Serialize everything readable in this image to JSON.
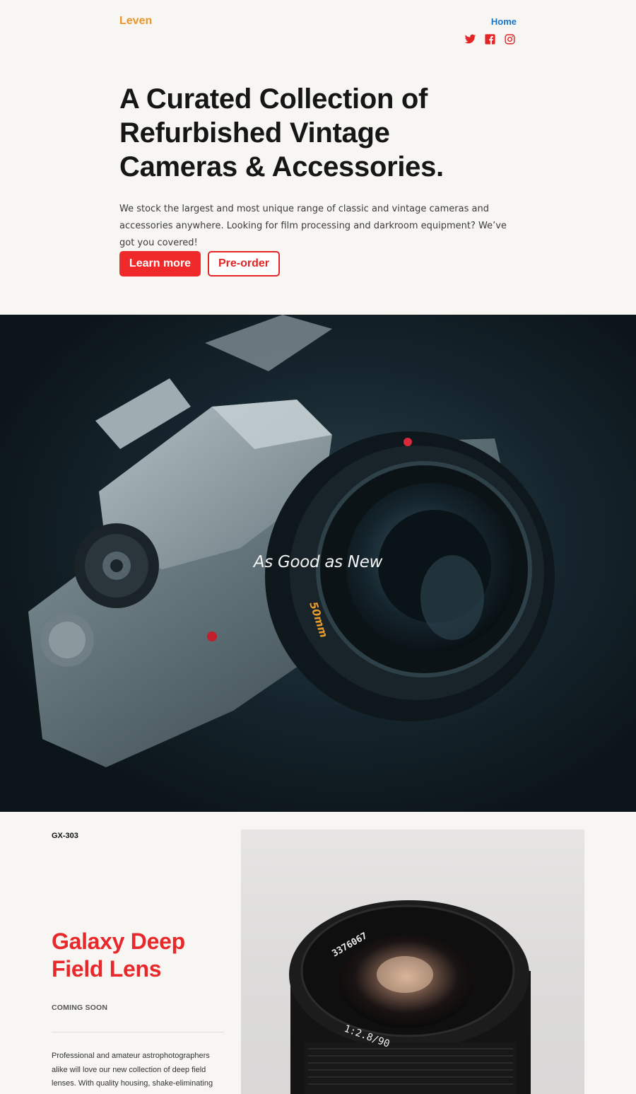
{
  "header": {
    "logo": "Leven",
    "nav": {
      "home_label": "Home"
    },
    "socials": [
      {
        "icon": "twitter-icon"
      },
      {
        "icon": "facebook-icon"
      },
      {
        "icon": "instagram-icon"
      }
    ]
  },
  "hero": {
    "title": "A Curated Collection of Refurbished Vintage Cameras & Accessories.",
    "description": "We stock the largest and most unique range of classic and vintage cameras and accessories anywhere. Looking for film processing and darkroom equipment? We’ve got you covered!",
    "primary_button": "Learn more",
    "secondary_button": "Pre-order"
  },
  "banner": {
    "caption": "As Good as New",
    "lens_text": "50mm"
  },
  "product": {
    "sku": "GX-303",
    "title": "Galaxy Deep Field Lens",
    "status": "COMING SOON",
    "description": "Professional and amateur astrophotographers alike will love our new collection of deep field lenses. With quality housing, shake-eliminating",
    "lens_serial": "3376067",
    "lens_spec": "1:2.8/90"
  },
  "colors": {
    "accent": "#f02a2a",
    "logo": "#e8962a",
    "link": "#1976c9",
    "background": "#f7f6f3"
  }
}
